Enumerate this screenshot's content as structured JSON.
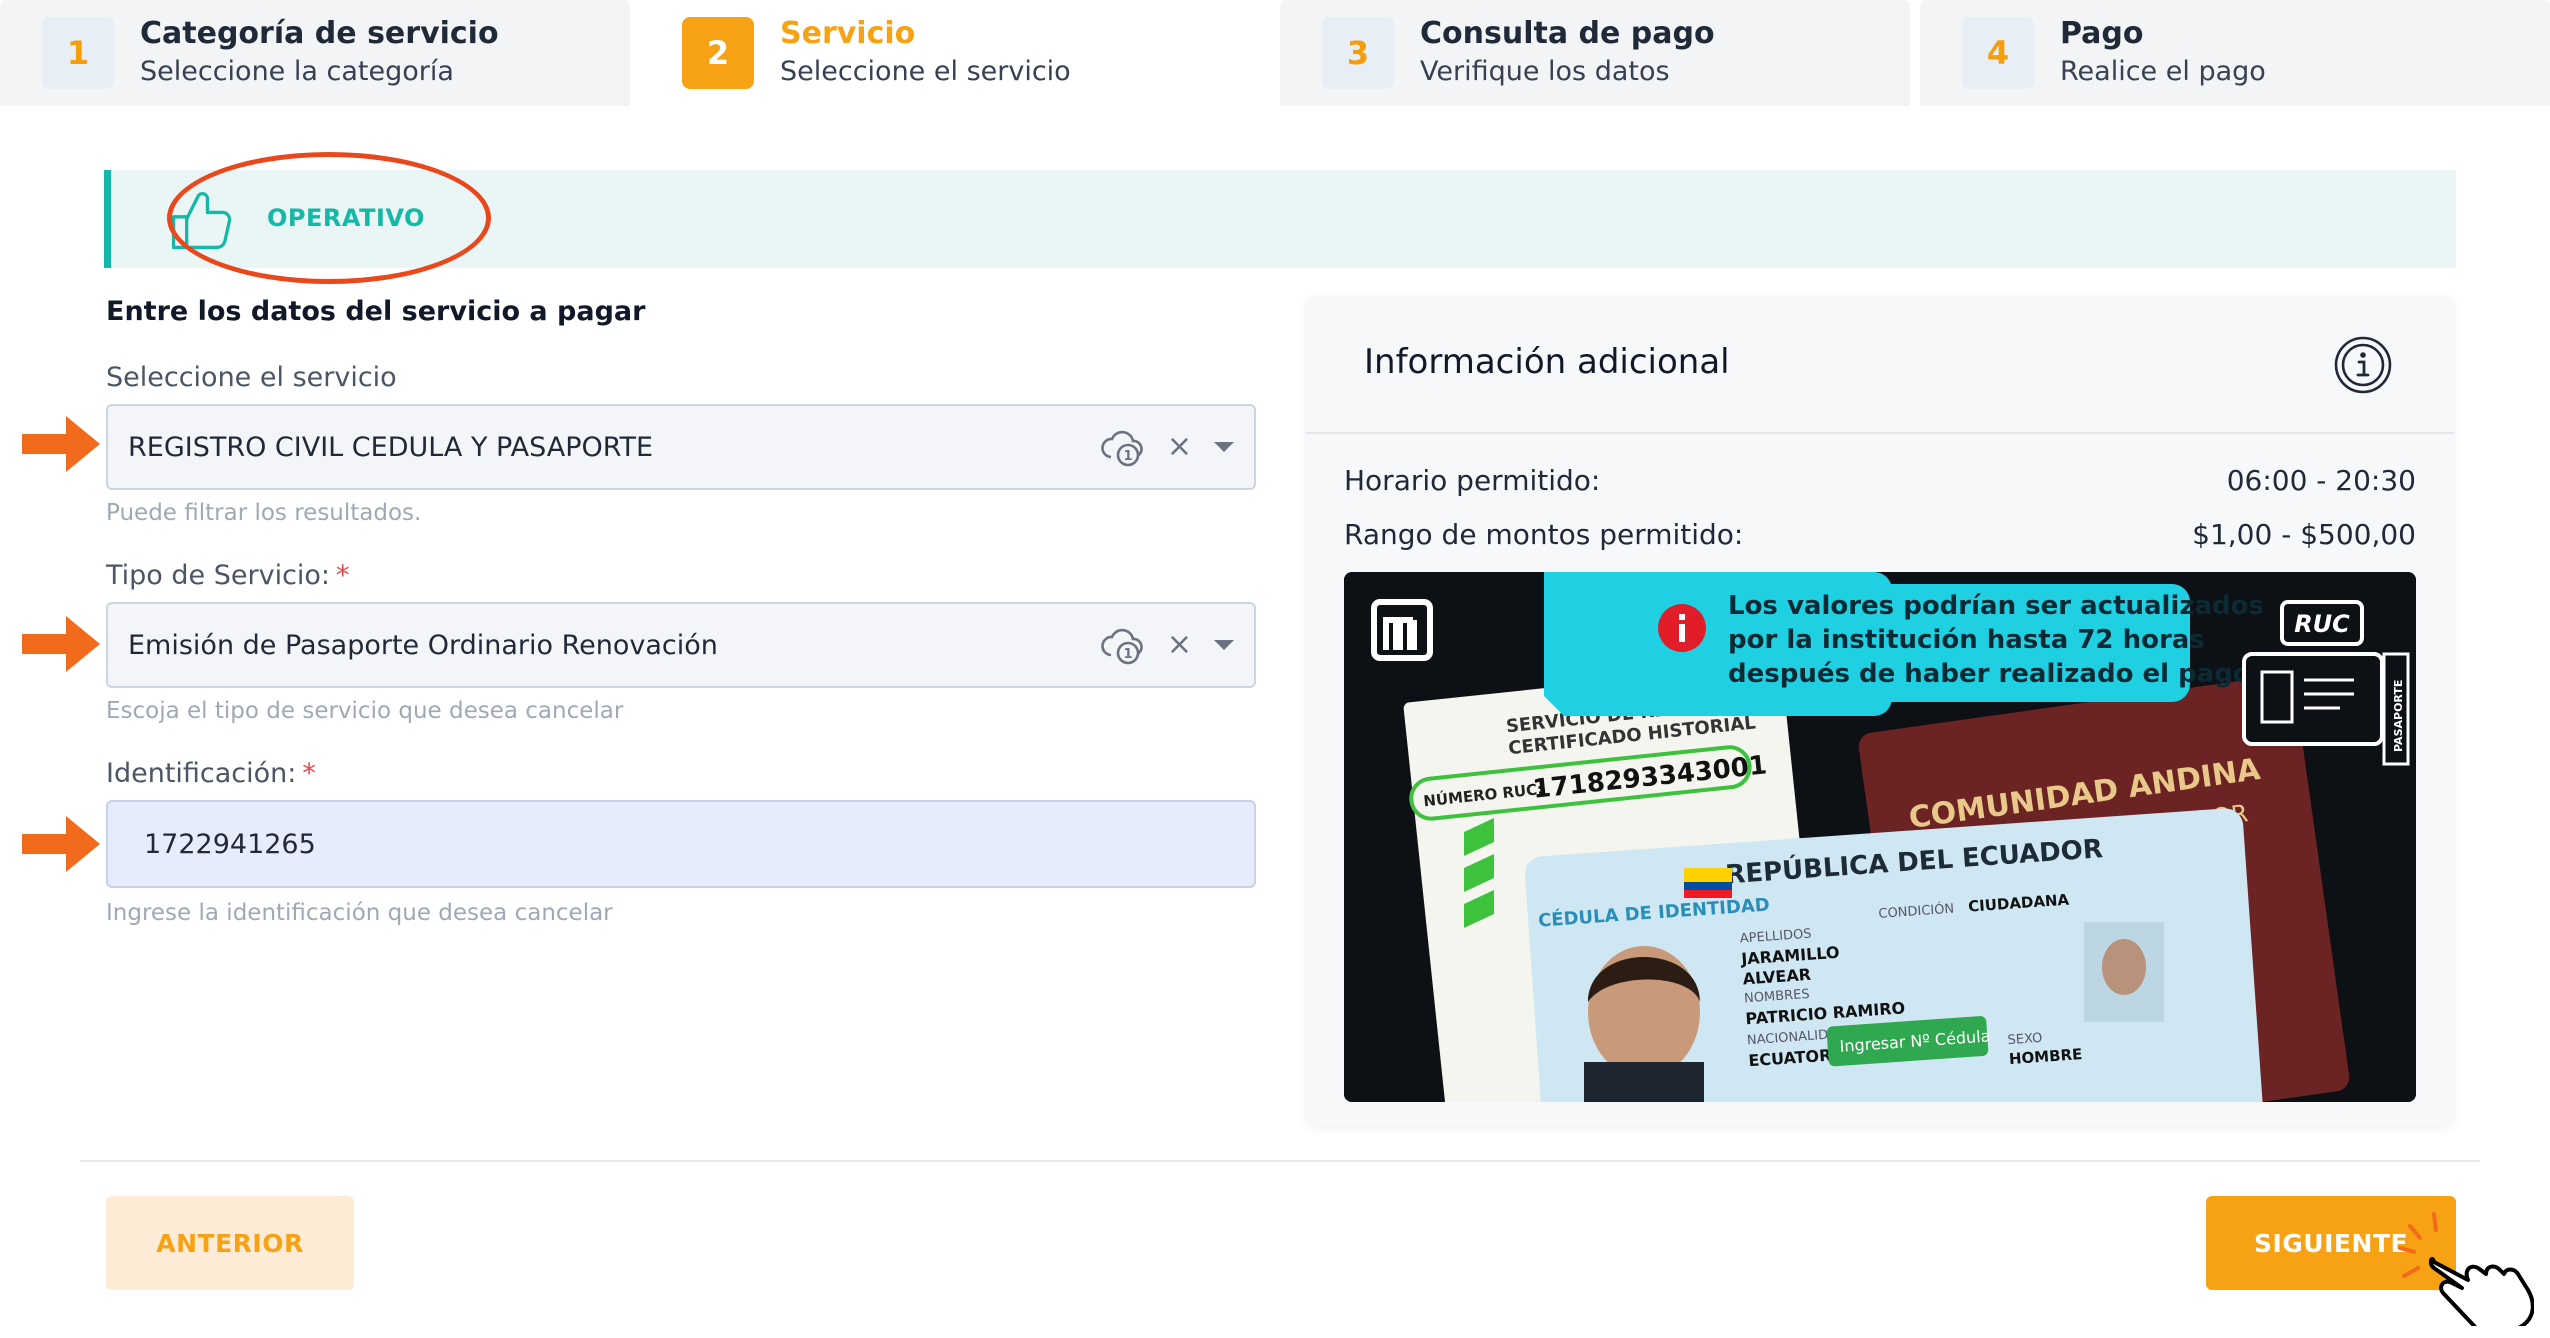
{
  "stepper": [
    {
      "number": "1",
      "title": "Categoría de servicio",
      "subtitle": "Seleccione la categoría",
      "active": false
    },
    {
      "number": "2",
      "title": "Servicio",
      "subtitle": "Seleccione el servicio",
      "active": true
    },
    {
      "number": "3",
      "title": "Consulta de pago",
      "subtitle": "Verifique los datos",
      "active": false
    },
    {
      "number": "4",
      "title": "Pago",
      "subtitle": "Realice el pago",
      "active": false
    }
  ],
  "status": {
    "label": "OPERATIVO",
    "icon": "thumbs-up-icon",
    "color": "#14b8a6",
    "highlight_color": "#e8481c"
  },
  "form": {
    "title": "Entre los datos del servicio a pagar",
    "service": {
      "label": "Seleccione el servicio",
      "value": "REGISTRO CIVIL CEDULA Y PASAPORTE",
      "hint": "Puede filtrar los resultados."
    },
    "service_type": {
      "label": "Tipo de Servicio:",
      "required": "*",
      "value": "Emisión de Pasaporte Ordinario Renovación",
      "hint": "Escoja el tipo de servicio que desea cancelar"
    },
    "identification": {
      "label": "Identificación:",
      "required": "*",
      "value": "1722941265",
      "hint": "Ingrese la identificación que desea cancelar"
    },
    "clear_symbol": "×"
  },
  "info": {
    "title": "Información adicional",
    "rows": [
      {
        "label": "Horario permitido:",
        "value": "06:00 - 20:30"
      },
      {
        "label": "Rango de montos permitido:",
        "value": "$1,00 - $500,00"
      }
    ],
    "banner": {
      "notice_line1": "Los valores podrían ser actualizados",
      "notice_line2": "por la institución hasta 72 horas",
      "notice_line3": "después de haber realizado el pago.",
      "ruc_badge": "RUC",
      "passport_title": "COMUNIDAD ANDINA",
      "passport_sub": "REPÚBLICA DEL ECUADOR",
      "id_title": "REPÚBLICA DEL ECUADOR",
      "id_side": "CÉDULA DE IDENTIDAD",
      "doc_ruc_label": "NÚMERO RUC:",
      "doc_ruc_number": "1718293343001",
      "doc_header": "SERVICIO DE RENTAS INTERNAS",
      "doc_header2": "CERTIFICADO HISTORIAL",
      "id_surname_label": "APELLIDOS",
      "id_surname1": "JARAMILLO",
      "id_surname2": "ALVEAR",
      "id_names_label": "NOMBRES",
      "id_names": "PATRICIO RAMIRO",
      "id_nationality_label": "NACIONALIDAD",
      "id_nationality": "ECUATORIANA",
      "id_condition_label": "CONDICIÓN",
      "id_condition": "CIUDADANA",
      "id_sex_label": "SEXO",
      "id_sex": "HOMBRE",
      "id_button": "Ingresar Nº Cédula",
      "side_badge": "PASAPORTE"
    }
  },
  "footer": {
    "prev_label": "ANTERIOR",
    "next_label": "SIGUIENTE"
  },
  "colors": {
    "accent": "#f7a215",
    "teal": "#14b8a6",
    "arrow": "#f26a1b"
  }
}
